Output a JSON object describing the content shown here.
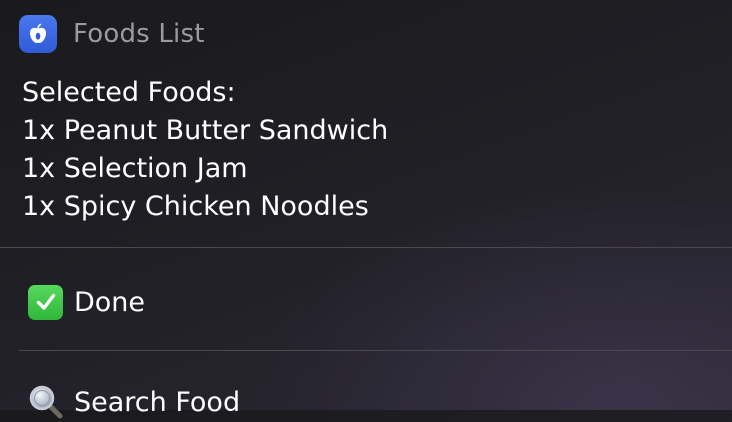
{
  "header": {
    "app_name": "Foods List",
    "icon": "apple-icon",
    "accent_color": "#3a67e3"
  },
  "summary": {
    "heading": "Selected Foods:",
    "items": [
      "1x Peanut Butter Sandwich",
      "1x Selection Jam",
      "1x Spicy Chicken Noodles"
    ]
  },
  "actions": [
    {
      "label": "Done",
      "icon": "check-mark-icon",
      "icon_color": "#3cc548"
    },
    {
      "label": "Search Food",
      "icon": "magnifying-glass-icon"
    }
  ]
}
